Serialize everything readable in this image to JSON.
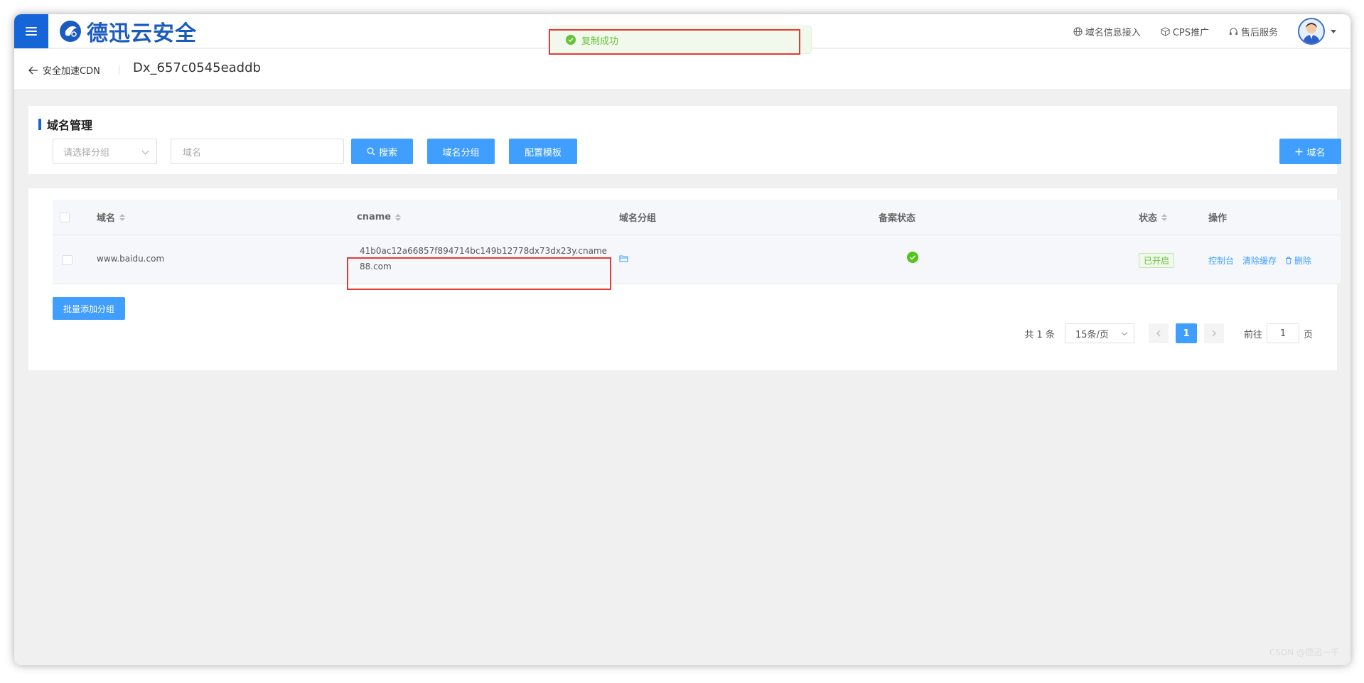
{
  "header": {
    "logo_text": "德迅云安全",
    "nav": [
      {
        "label": "域名信息接入",
        "icon": "globe-icon"
      },
      {
        "label": "CPS推广",
        "icon": "box-icon"
      },
      {
        "label": "售后服务",
        "icon": "headset-icon"
      }
    ],
    "brand_color": "#1565d8"
  },
  "breadcrumb": {
    "back_label": "安全加速CDN",
    "title": "Dx_657c0545eaddb"
  },
  "toast": {
    "message": "复制成功",
    "color": "#67c23a"
  },
  "filter": {
    "section_title": "域名管理",
    "group_placeholder": "请选择分组",
    "domain_placeholder": "域名",
    "search_label": "搜索",
    "group_label": "域名分组",
    "template_label": "配置模板",
    "add_label": "域名"
  },
  "table": {
    "columns": [
      "域名",
      "cname",
      "域名分组",
      "备案状态",
      "状态",
      "操作"
    ],
    "rows": [
      {
        "domain": "www.baidu.com",
        "cname": "41b0ac12a66857f894714bc149b12778dx73dx23y.cname88.com",
        "group_icon": "folder-icon",
        "icp_status": "check-circle-icon",
        "status": "已开启",
        "actions": [
          "控制台",
          "清除缓存",
          "删除"
        ]
      }
    ],
    "batch_label": "批量添加分组"
  },
  "pagination": {
    "total_text": "共 1 条",
    "page_size": "15条/页",
    "current_page": "1",
    "goto_prefix": "前往",
    "goto_value": "1",
    "goto_suffix": "页"
  },
  "watermark": "CSDN @德迅一千"
}
